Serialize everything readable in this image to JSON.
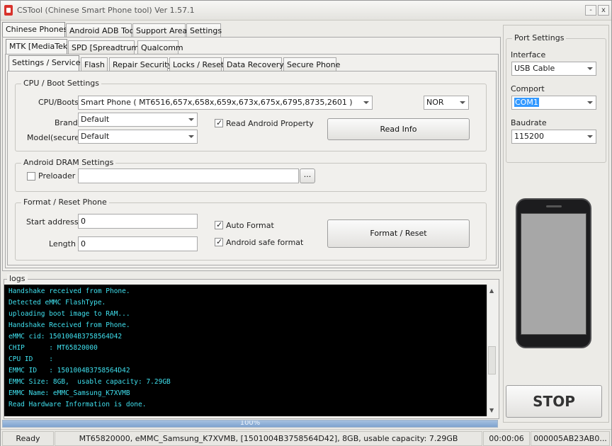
{
  "window": {
    "title": "CSTool (Chinese Smart Phone tool)  Ver 1.57.1",
    "minimize": "-",
    "close": "x"
  },
  "main_tabs": [
    "Chinese Phones",
    "Android ADB Tool",
    "Support Area",
    "Settings"
  ],
  "chip_tabs": [
    "MTK [MediaTek]",
    "SPD [Spreadtrum]",
    "Qualcomm"
  ],
  "func_tabs": [
    "Settings / Services",
    "Flash",
    "Repair Security",
    "Locks / Reset",
    "Data Recovery",
    "Secure Phone"
  ],
  "cpu_group": {
    "title": "CPU / Boot Settings",
    "cpu_label": "CPU/Boots",
    "cpu_value": "Smart Phone ( MT6516,657x,658x,659x,673x,675x,6795,8735,2601 )",
    "storage_value": "NOR",
    "brand_label": "Brand",
    "brand_value": "Default",
    "model_label": "Model(secure)",
    "model_value": "Default",
    "read_prop_label": "Read Android Property",
    "read_info_button": "Read Info"
  },
  "dram_group": {
    "title": "Android DRAM Settings",
    "preloader_label": "Preloader",
    "preloader_value": "",
    "browse_button": "..."
  },
  "format_group": {
    "title": "Format / Reset Phone",
    "start_label": "Start address",
    "start_value": "0",
    "length_label": "Length",
    "length_value": "0",
    "auto_format_label": "Auto Format",
    "safe_format_label": "Android safe format",
    "format_button": "Format  / Reset"
  },
  "port_settings": {
    "title": "Port Settings",
    "interface_label": "Interface",
    "interface_value": "USB Cable",
    "comport_label": "Comport",
    "comport_value": "COM1",
    "baudrate_label": "Baudrate",
    "baudrate_value": "115200",
    "stop_button": "STOP"
  },
  "logs": {
    "title": "logs",
    "lines": [
      "Handshake received from Phone.",
      "Detected eMMC FlashType.",
      "uploading boot image to RAM...",
      "Handshake Received from Phone.",
      "eMMC cid: 1501004B3758564D42",
      "CHIP      : MT65820000",
      "CPU ID    :",
      "EMMC ID   : 1501004B3758564D42",
      "EMMC Size: 8GB,  usable capacity: 7.29GB",
      "EMMC Name: eMMC_Samsung_K7XVMB",
      "Read Hardware Information is done."
    ]
  },
  "progress": {
    "value": 1.0,
    "text": "100%"
  },
  "status_bar": {
    "state": "Ready",
    "info": "MT65820000, eMMC_Samsung_K7XVMB, [1501004B3758564D42], 8GB, usable capacity: 7.29GB",
    "timer": "00:00:06",
    "serial": "000005AB23AB0..."
  },
  "colors": {
    "log_text": "#3fe0ee",
    "log_bg": "#000000",
    "selection": "#3399ff"
  }
}
